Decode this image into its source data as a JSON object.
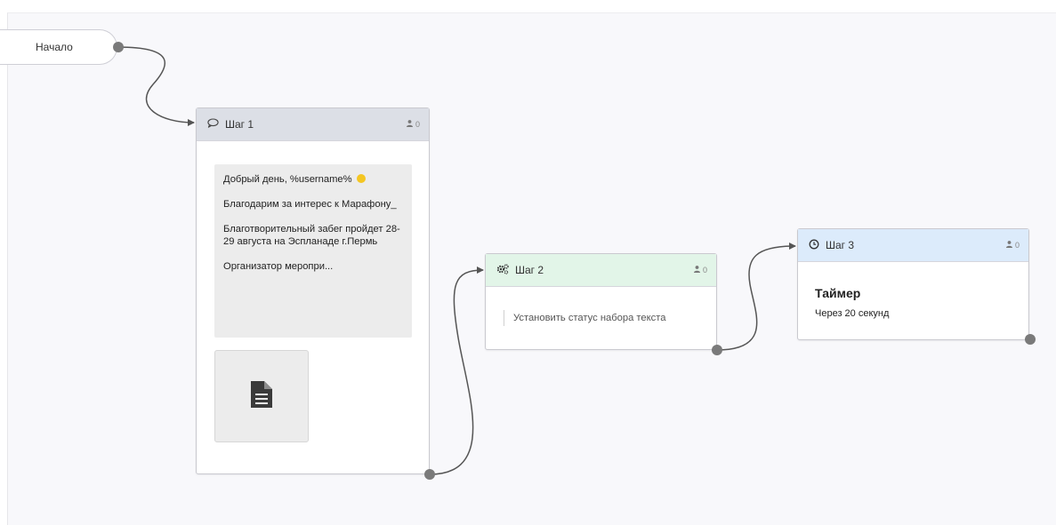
{
  "start": {
    "label": "Начало"
  },
  "nodes": {
    "step1": {
      "title": "Шаг 1",
      "user_count": "0",
      "message": {
        "line1": "Добрый день, %username%",
        "line2": "Благодарим за интерес к Марафону_",
        "line3": "Благотворительный забег пройдет 28-29 августа на Эспланаде г.Пермь",
        "line4": "Организатор меропри..."
      },
      "attachment_icon": "document-icon"
    },
    "step2": {
      "title": "Шаг 2",
      "user_count": "0",
      "action": "Установить статус набора текста"
    },
    "step3": {
      "title": "Шаг 3",
      "user_count": "0",
      "timer_title": "Таймер",
      "timer_text": "Через 20 секунд"
    }
  },
  "colors": {
    "header_message": "#dcdfe6",
    "header_action": "#e2f5e8",
    "header_timer": "#dcebfb",
    "connector": "#555555",
    "port": "#7a7a7a"
  },
  "icons": {
    "step1": "speech-bubble-icon",
    "step2": "gears-icon",
    "step3": "clock-icon",
    "users": "user-icon"
  }
}
